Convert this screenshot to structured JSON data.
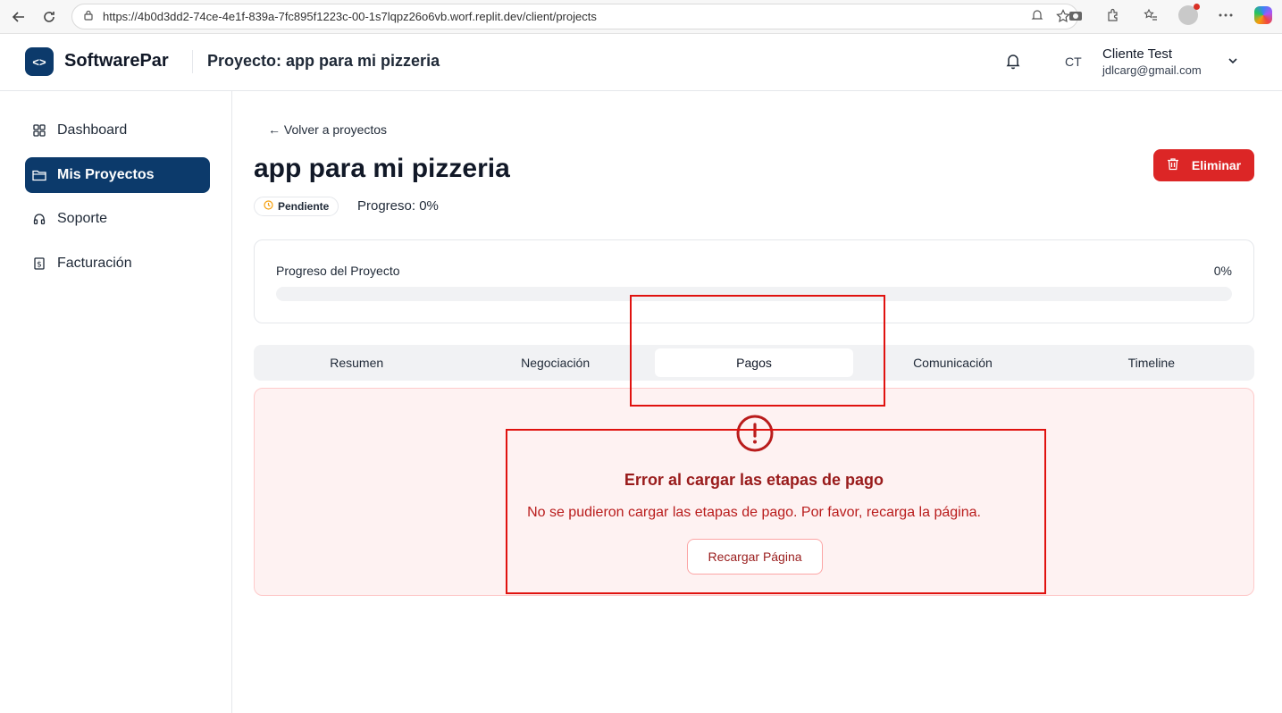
{
  "browser": {
    "url": "https://4b0d3dd2-74ce-4e1f-839a-7fc895f1223c-00-1s7lqpz26o6vb.worf.replit.dev/client/projects"
  },
  "header": {
    "logo_glyph": "<>",
    "brand": "SoftwarePar",
    "project_title": "Proyecto: app para mi pizzeria",
    "user_initials": "CT",
    "user_name": "Cliente Test",
    "user_email": "jdlcarg@gmail.com"
  },
  "sidebar": {
    "items": [
      {
        "label": "Dashboard",
        "icon": "grid-icon"
      },
      {
        "label": "Mis Proyectos",
        "icon": "folder-icon",
        "active": true
      },
      {
        "label": "Soporte",
        "icon": "headset-icon"
      },
      {
        "label": "Facturación",
        "icon": "invoice-icon"
      }
    ]
  },
  "main": {
    "back_link": "← Volver a proyectos",
    "title": "app para mi pizzeria",
    "delete_label": "Eliminar",
    "status": "Pendiente",
    "progress_text": "Progreso: 0%",
    "progress_card": {
      "label": "Progreso del Proyecto",
      "value_text": "0%",
      "value": 0
    },
    "tabs": [
      {
        "label": "Resumen"
      },
      {
        "label": "Negociación"
      },
      {
        "label": "Pagos",
        "active": true
      },
      {
        "label": "Comunicación"
      },
      {
        "label": "Timeline"
      }
    ],
    "error": {
      "title": "Error al cargar las etapas de pago",
      "message": "No se pudieron cargar las etapas de pago. Por favor, recarga la página.",
      "button": "Recargar Página"
    }
  },
  "colors": {
    "brand": "#0c3a6b",
    "danger": "#dc2626",
    "annotation": "#e0120f",
    "pending": "#f59e0b"
  }
}
